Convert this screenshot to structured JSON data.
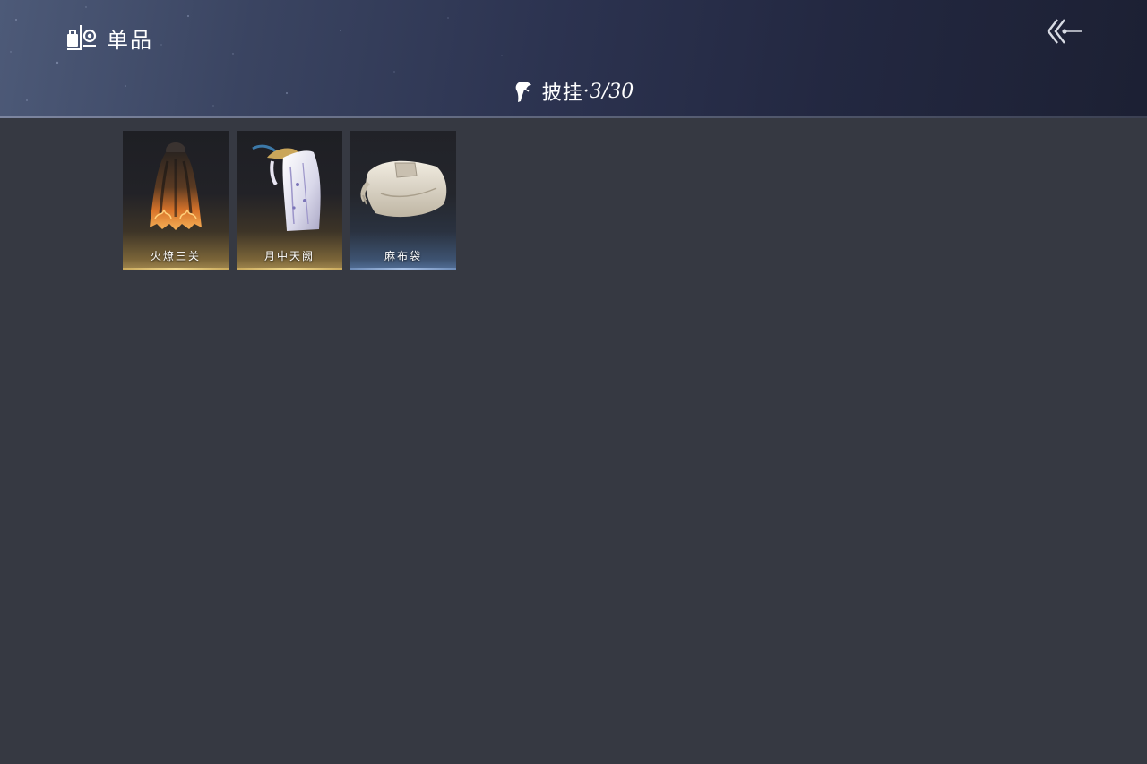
{
  "header": {
    "title": "单品",
    "title_icon": "wardrobe-icon",
    "back_icon": "back-arrow-icon"
  },
  "category": {
    "icon": "cape-icon",
    "label": "披挂",
    "count": "·3/30"
  },
  "items": [
    {
      "name": "火燎三关",
      "rarity": "gold",
      "image": "flaming-cape"
    },
    {
      "name": "月中天阙",
      "rarity": "gold",
      "image": "moon-white-cape"
    },
    {
      "name": "麻布袋",
      "rarity": "blue",
      "image": "burlap-sack"
    }
  ],
  "colors": {
    "background": "#363942",
    "header_dark": "#1c2033",
    "gold_rarity": "#c9a95c",
    "blue_rarity": "#6e8cb8"
  }
}
